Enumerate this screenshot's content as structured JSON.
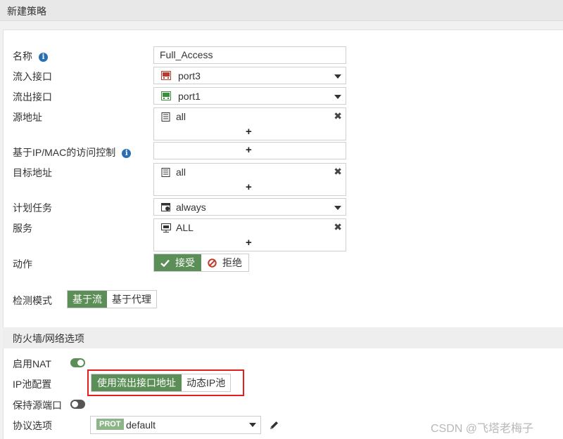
{
  "page_title": "新建策略",
  "colors": {
    "accent": "#5b8f57",
    "info": "#2a6fb4",
    "highlight_border": "#e02020"
  },
  "form": {
    "name": {
      "label": "名称",
      "value": "Full_Access"
    },
    "incoming": {
      "label": "流入接口",
      "value": "port3",
      "icon": "port-icon-red"
    },
    "outgoing": {
      "label": "流出接口",
      "value": "port1",
      "icon": "port-icon-green"
    },
    "source": {
      "label": "源地址",
      "value": "all",
      "icon": "address-icon"
    },
    "ipmac": {
      "label": "基于IP/MAC的访问控制"
    },
    "dest": {
      "label": "目标地址",
      "value": "all",
      "icon": "address-icon"
    },
    "schedule": {
      "label": "计划任务",
      "value": "always",
      "icon": "schedule-icon"
    },
    "service": {
      "label": "服务",
      "value": "ALL",
      "icon": "service-icon"
    },
    "action": {
      "label": "动作",
      "accept": "接受",
      "deny": "拒绝",
      "selected": "accept"
    },
    "inspection": {
      "label": "检测模式",
      "flow": "基于流",
      "proxy": "基于代理",
      "selected": "flow"
    }
  },
  "firewall_section": {
    "title": "防火墙/网络选项",
    "nat": {
      "label": "启用NAT",
      "enabled": true
    },
    "ippool": {
      "label": "IP池配置",
      "use_outgoing": "使用流出接口地址",
      "dynamic": "动态IP池",
      "selected": "use_outgoing"
    },
    "preserve_port": {
      "label": "保持源端口",
      "enabled": false
    },
    "protocol": {
      "label": "协议选项",
      "tag": "PROT",
      "value": "default"
    }
  },
  "symbols": {
    "plus": "+",
    "remove": "✖"
  },
  "watermark": "CSDN @飞塔老梅子"
}
